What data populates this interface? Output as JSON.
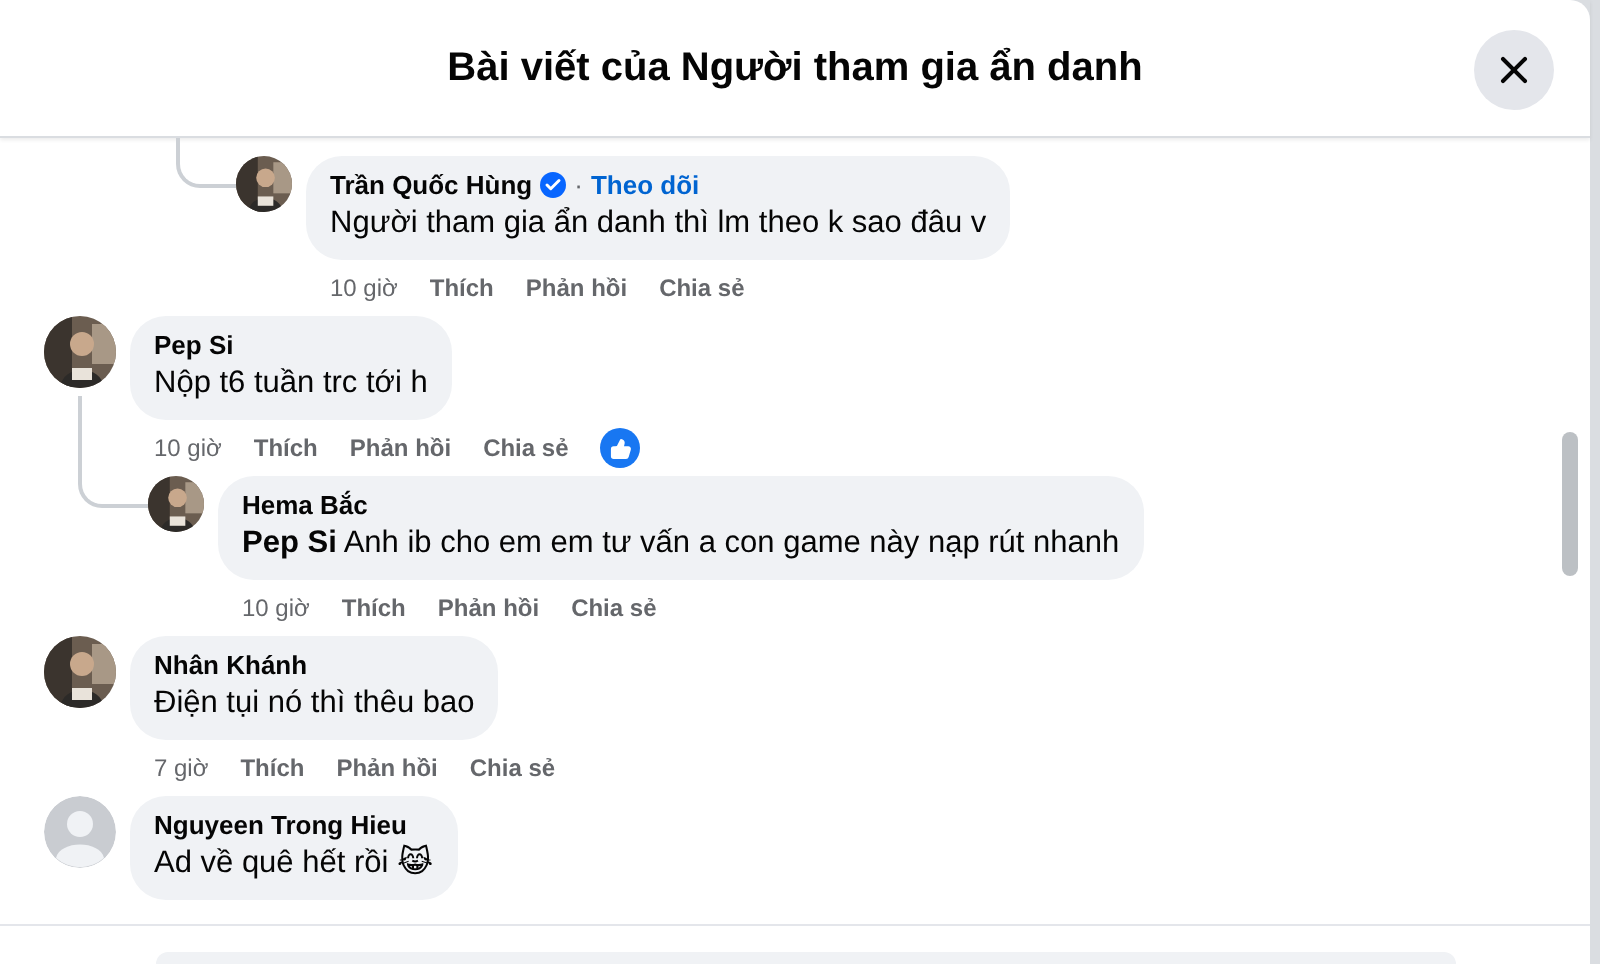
{
  "dialog": {
    "title": "Bài viết của Người tham gia ẩn danh"
  },
  "continued_replies": [
    {
      "author": "Trần Quốc Hùng",
      "verified": true,
      "separator": "·",
      "follow": "Theo dõi",
      "text": "Người tham gia ẩn danh thì lm theo k sao đâu v",
      "time": "10 giờ",
      "actions": [
        "Thích",
        "Phản hồi",
        "Chia sẻ"
      ]
    }
  ],
  "comments": [
    {
      "author": "Pep Si",
      "text": "Nộp t6 tuần trc tới h",
      "time": "10 giờ",
      "actions": [
        "Thích",
        "Phản hồi",
        "Chia sẻ"
      ],
      "reaction": {
        "kind": "like"
      },
      "children": [
        {
          "author": "Hema Bắc",
          "text": "**Pep Si** Anh ib cho em em tư vấn a con game này nạp rút nhanh",
          "time": "10 giờ",
          "actions": [
            "Thích",
            "Phản hồi",
            "Chia sẻ"
          ]
        }
      ]
    },
    {
      "author": "Nhân Khánh",
      "text": "Điện tụi nó thì thêu bao",
      "time": "7 giờ",
      "actions": [
        "Thích",
        "Phản hồi",
        "Chia sẻ"
      ]
    },
    {
      "author": "Nguyeen Trong Hieu",
      "avatar": {
        "kind": "default"
      },
      "text": "Ad về quê hết rồi 😹"
    }
  ]
}
